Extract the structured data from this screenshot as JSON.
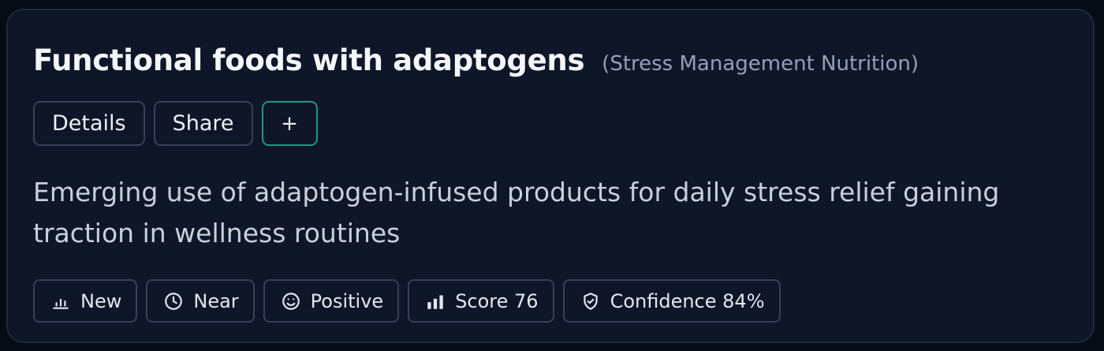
{
  "card": {
    "title": "Functional foods with adaptogens",
    "category": "(Stress Management Nutrition)",
    "description": "Emerging use of adaptogen-infused products for daily stress relief gaining traction in wellness routines"
  },
  "actions": {
    "details_label": "Details",
    "share_label": "Share",
    "add_label": "+"
  },
  "badges": [
    {
      "icon": "bar-chart-icon",
      "label": "New"
    },
    {
      "icon": "clock-icon",
      "label": "Near"
    },
    {
      "icon": "smile-icon",
      "label": "Positive"
    },
    {
      "icon": "signal-bars-icon",
      "label": "Score 76"
    },
    {
      "icon": "shield-check-icon",
      "label": "Confidence 84%"
    }
  ],
  "colors": {
    "page_background": "#070b16",
    "card_background": "#0e1628",
    "accent": "#1f9a80",
    "border": "#374254"
  }
}
